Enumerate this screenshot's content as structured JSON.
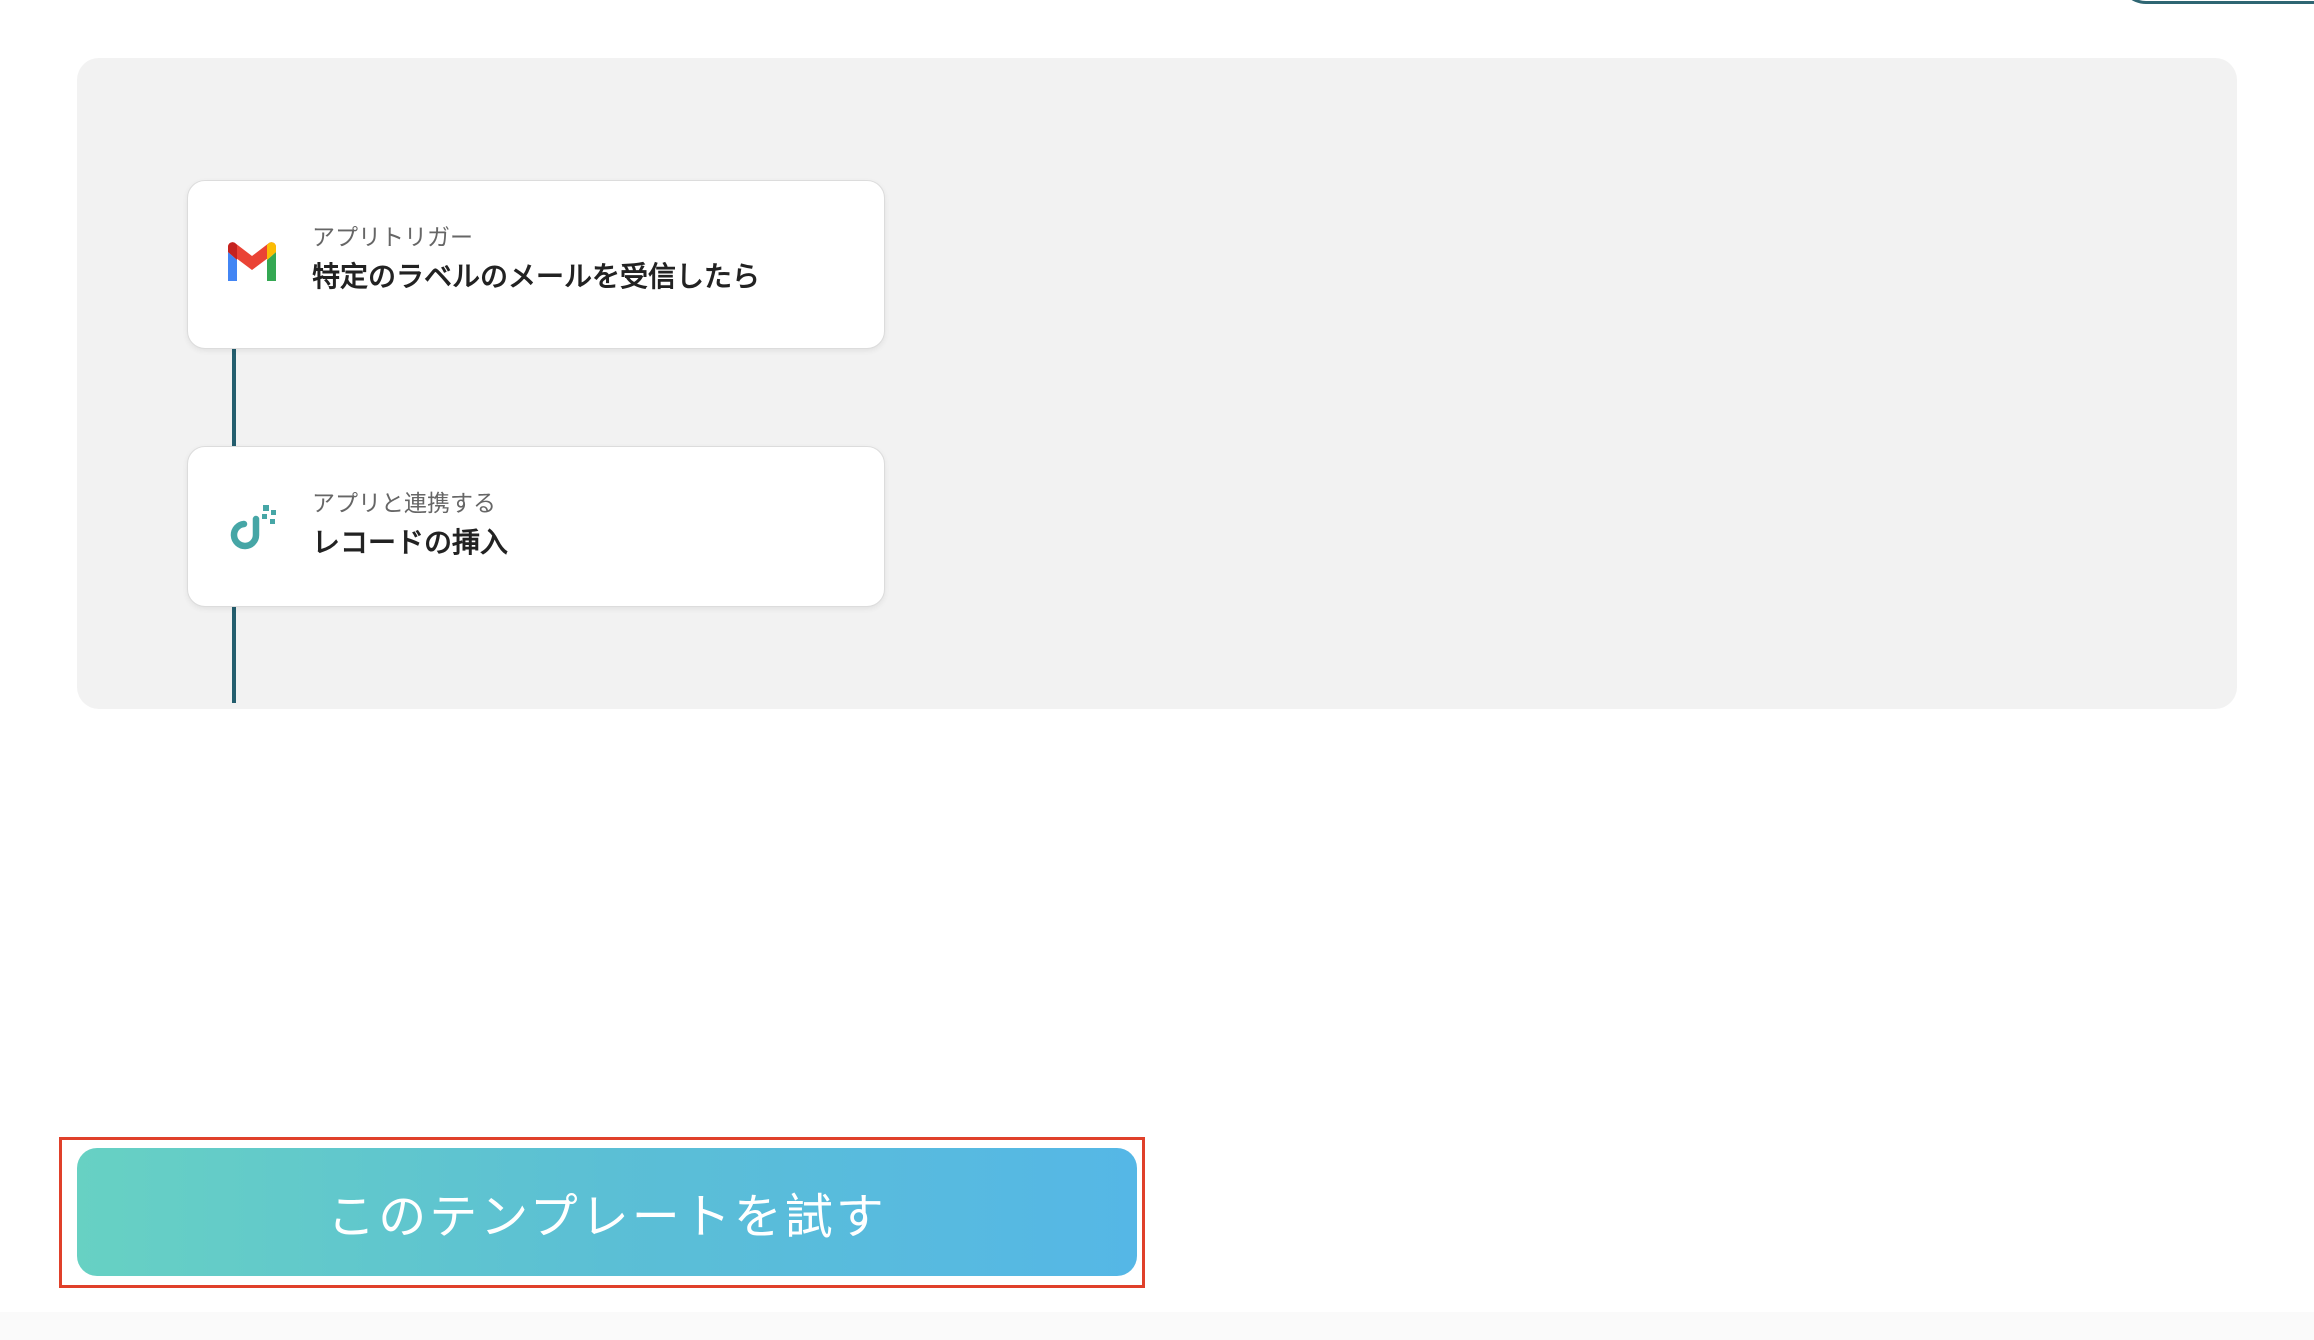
{
  "flow": {
    "steps": [
      {
        "kind": "アプリトリガー",
        "title": "特定のラベルのメールを受信したら",
        "icon": "gmail-icon"
      },
      {
        "kind": "アプリと連携する",
        "title": "レコードの挿入",
        "icon": "database-app-icon"
      }
    ],
    "connector_color": "#245e6e"
  },
  "cta": {
    "label": "このテンプレートを試す",
    "gradient_start": "#67d1c3",
    "gradient_end": "#55b7e6",
    "highlight_color": "#e0402a"
  }
}
